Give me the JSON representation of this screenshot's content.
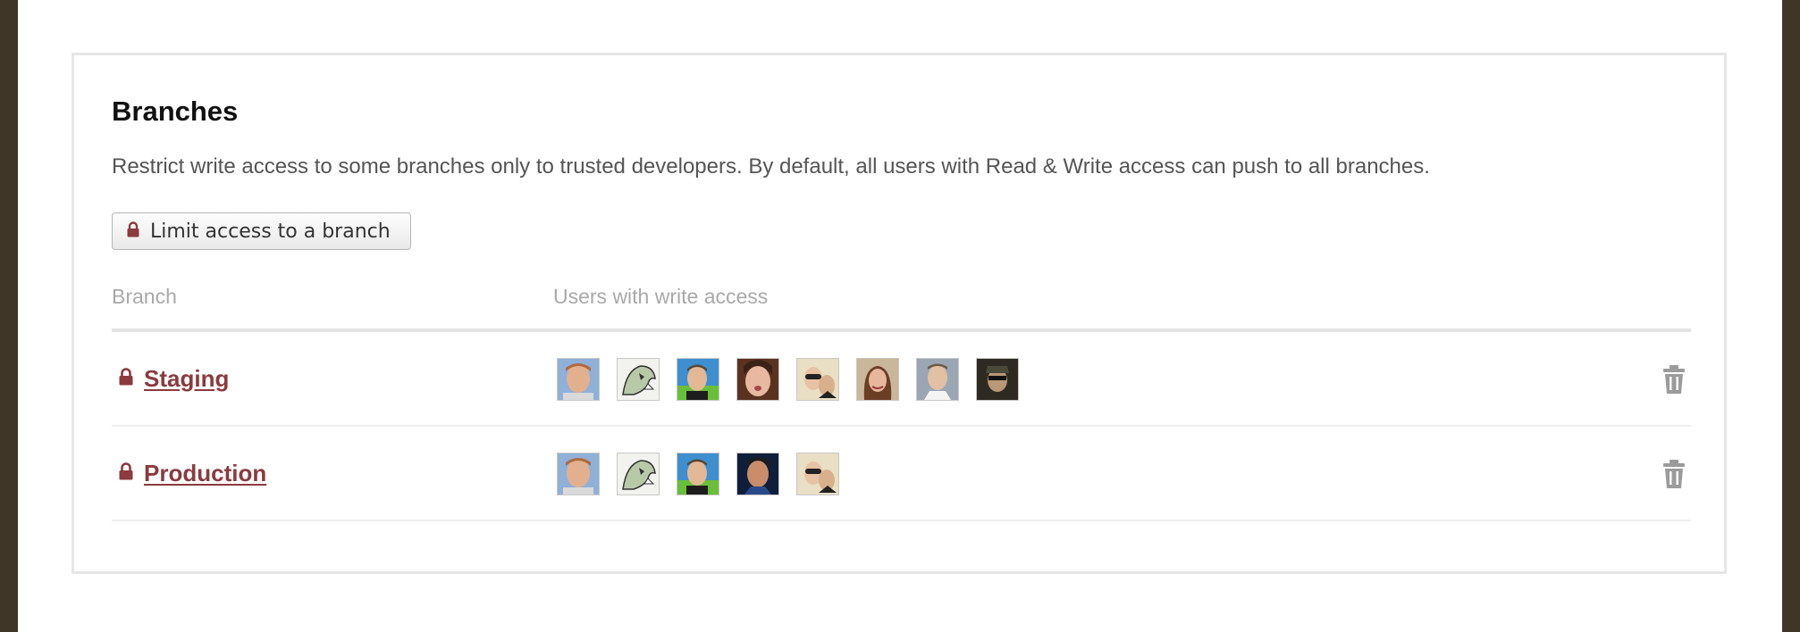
{
  "panel": {
    "title": "Branches",
    "description": "Restrict write access to some branches only to trusted developers. By default, all users with Read & Write access can push to all branches.",
    "limit_button_label": "Limit access to a branch",
    "accent_color": "#8b3a3e"
  },
  "table": {
    "headers": {
      "branch": "Branch",
      "users": "Users with write access"
    },
    "rows": [
      {
        "branch": "Staging",
        "avatars": [
          "user-avatar-1",
          "user-avatar-2",
          "user-avatar-3",
          "user-avatar-4",
          "user-avatar-5",
          "user-avatar-6",
          "user-avatar-7",
          "user-avatar-8"
        ]
      },
      {
        "branch": "Production",
        "avatars": [
          "user-avatar-1",
          "user-avatar-2",
          "user-avatar-3",
          "user-avatar-9",
          "user-avatar-5"
        ]
      }
    ]
  },
  "icons": {
    "lock": "lock-icon",
    "delete": "trash-icon"
  }
}
